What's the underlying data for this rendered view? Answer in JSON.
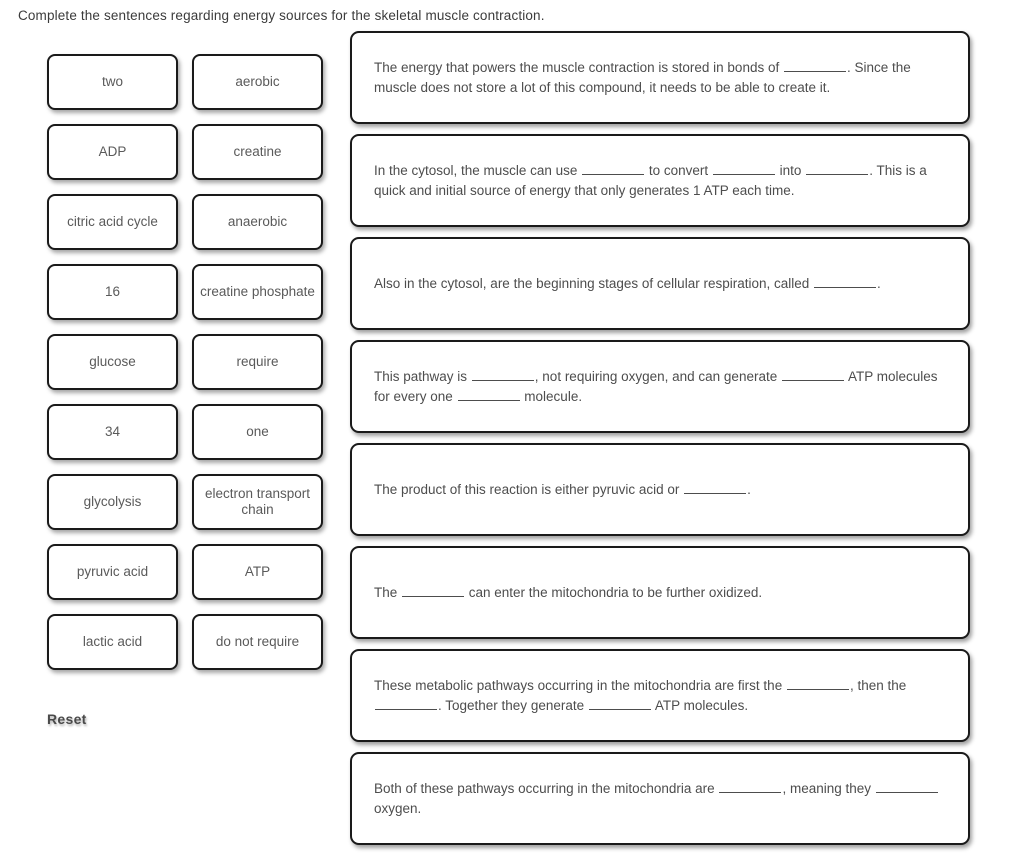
{
  "prompt": "Complete the sentences regarding energy sources for the skeletal muscle contraction.",
  "reset_label": "Reset",
  "tiles": [
    {
      "col_a": "two",
      "col_b": "aerobic"
    },
    {
      "col_a": "ADP",
      "col_b": "creatine"
    },
    {
      "col_a": "citric acid cycle",
      "col_b": "anaerobic"
    },
    {
      "col_a": "16",
      "col_b": "creatine phosphate"
    },
    {
      "col_a": "glucose",
      "col_b": "require"
    },
    {
      "col_a": "34",
      "col_b": "one"
    },
    {
      "col_a": "glycolysis",
      "col_b": "electron transport chain"
    },
    {
      "col_a": "pyruvic acid",
      "col_b": "ATP"
    },
    {
      "col_a": "lactic acid",
      "col_b": "do not require"
    }
  ],
  "sentences": [
    {
      "size": "tall",
      "parts": [
        "The energy that powers the muscle contraction is stored in bonds of ",
        "BLANK",
        ". Since the muscle does not store a lot of this compound, it needs to be able to create it."
      ]
    },
    {
      "size": "tall",
      "parts": [
        "In the cytosol, the muscle can use ",
        "BLANK",
        " to convert ",
        "BLANK",
        " into ",
        "BLANK",
        ". This is a quick and initial source of energy that only generates 1 ATP each time."
      ]
    },
    {
      "size": "tall",
      "parts": [
        "Also in the cytosol, are the beginning stages of cellular respiration, called ",
        "BLANK",
        "."
      ]
    },
    {
      "size": "tall",
      "parts": [
        "This pathway is ",
        "BLANK",
        ", not requiring oxygen, and can generate ",
        "BLANK",
        " ATP molecules for every one ",
        "BLANK",
        " molecule."
      ]
    },
    {
      "size": "tall",
      "parts": [
        "The product of this reaction is either pyruvic acid or  ",
        "BLANK",
        "."
      ]
    },
    {
      "size": "tall",
      "parts": [
        "The ",
        "BLANK",
        " can enter the mitochondria to be further oxidized."
      ]
    },
    {
      "size": "tall",
      "parts": [
        "These metabolic pathways occurring in the mitochondria are first the ",
        "BLANK",
        ", then the ",
        "BLANK",
        ". Together they generate ",
        "BLANK",
        " ATP molecules."
      ]
    },
    {
      "size": "tall",
      "parts": [
        "Both of these pathways occurring in the mitochondria are ",
        "BLANK",
        ", meaning they ",
        "BLANK",
        " oxygen."
      ]
    }
  ],
  "colors": {
    "tile_border": "#1a1a1a",
    "tile_text": "#5a5a5a",
    "sentence_text": "#4d4d4d",
    "prompt_text": "#3b3b3b",
    "reset_text": "#4a4a4a",
    "background": "#ffffff"
  }
}
